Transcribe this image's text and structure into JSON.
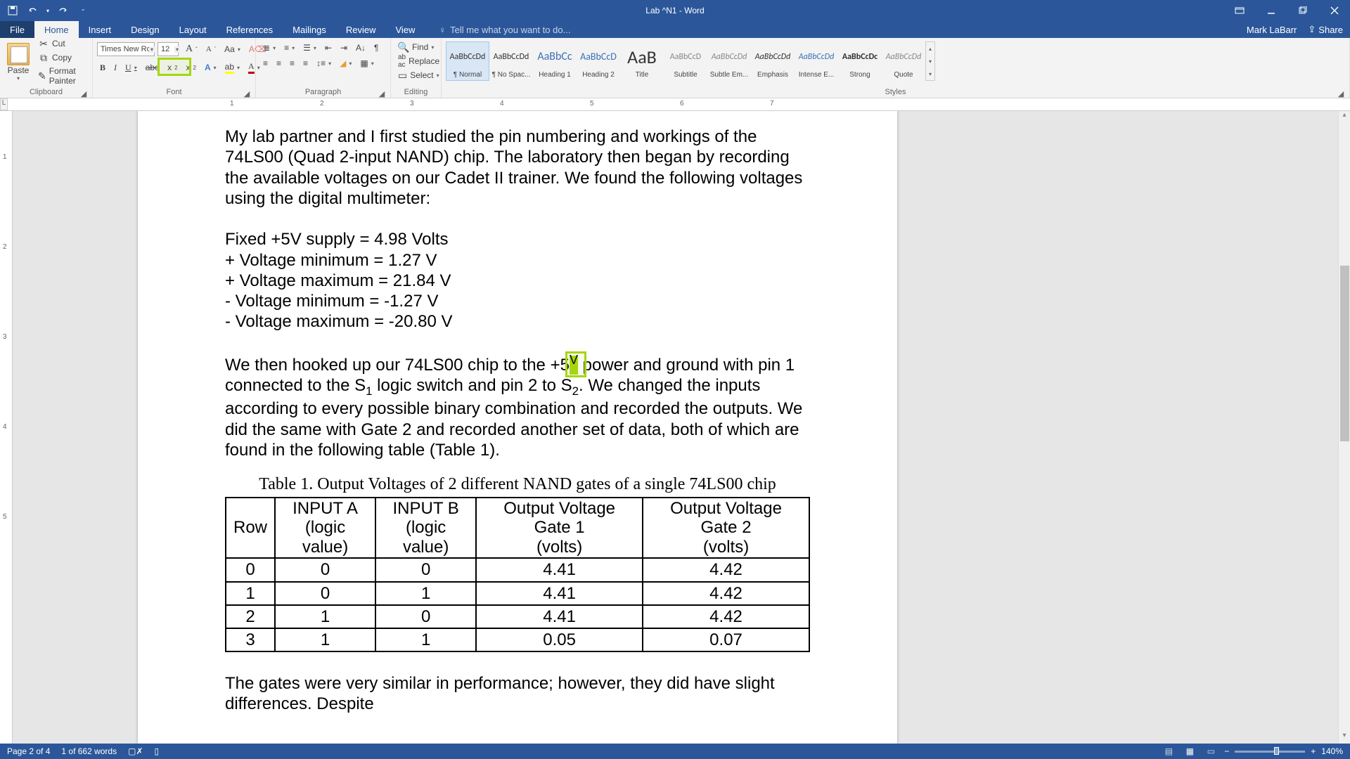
{
  "titlebar": {
    "doc_title": "Lab ^N1 - Word",
    "user": "Mark LaBarr",
    "share": "Share"
  },
  "tabs": {
    "file": "File",
    "home": "Home",
    "insert": "Insert",
    "design": "Design",
    "layout": "Layout",
    "references": "References",
    "mailings": "Mailings",
    "review": "Review",
    "view": "View",
    "tell_me": "Tell me what you want to do..."
  },
  "ribbon": {
    "paste": "Paste",
    "cut": "Cut",
    "copy": "Copy",
    "format_painter": "Format Painter",
    "clipboard": "Clipboard",
    "font_name": "Times New Ro",
    "font_size": "12",
    "font_group": "Font",
    "paragraph_group": "Paragraph",
    "find": "Find",
    "replace": "Replace",
    "select": "Select",
    "editing": "Editing",
    "styles": "Styles",
    "style_items": [
      {
        "preview": "AaBbCcDd",
        "label": "¶ Normal",
        "size": "12px",
        "color": "#333"
      },
      {
        "preview": "AaBbCcDd",
        "label": "¶ No Spac...",
        "size": "12px",
        "color": "#333"
      },
      {
        "preview": "AaBbCc",
        "label": "Heading 1",
        "size": "16px",
        "color": "#3b6fb6"
      },
      {
        "preview": "AaBbCcD",
        "label": "Heading 2",
        "size": "14px",
        "color": "#3b6fb6"
      },
      {
        "preview": "AaB",
        "label": "Title",
        "size": "26px",
        "color": "#333"
      },
      {
        "preview": "AaBbCcD",
        "label": "Subtitle",
        "size": "12px",
        "color": "#888"
      },
      {
        "preview": "AaBbCcDd",
        "label": "Subtle Em...",
        "size": "12px",
        "color": "#888",
        "italic": true
      },
      {
        "preview": "AaBbCcDd",
        "label": "Emphasis",
        "size": "12px",
        "color": "#333",
        "italic": true
      },
      {
        "preview": "AaBbCcDd",
        "label": "Intense E...",
        "size": "12px",
        "color": "#3b6fb6",
        "italic": true
      },
      {
        "preview": "AaBbCcDc",
        "label": "Strong",
        "size": "12px",
        "color": "#333",
        "bold": true
      },
      {
        "preview": "AaBbCcDd",
        "label": "Quote",
        "size": "12px",
        "color": "#888",
        "italic": true
      }
    ]
  },
  "document": {
    "p1": "My lab partner and I first studied the pin numbering and workings of the 74LS00 (Quad 2-input NAND) chip. The laboratory then began by recording the available voltages on our Cadet II trainer. We found the following voltages using the digital multimeter:",
    "l1": "Fixed +5V supply = 4.98 Volts",
    "l2": "+ Voltage minimum = 1.27 V",
    "l3": "+ Voltage maximum = 21.84 V",
    "l4": "- Voltage minimum = -1.27 V",
    "l5": "- Voltage maximum = -20.80 V",
    "p2a": "We then hooked up our 74LS00 chip to the +5",
    "p2b": " power and ground with pin 1 connected to the S",
    "p2c": " logic switch and pin 2 to S",
    "p2d": ". We changed the inputs according to every possible binary combination and recorded the outputs. We did the same with Gate 2 and recorded another set of data, both of which are found in the following table (Table 1).",
    "sup_v": "V",
    "sub_1": "1",
    "sub_2": "2",
    "table_caption": "Table 1. Output Voltages of 2 different NAND gates of a single 74LS00 chip",
    "headers": {
      "row": "Row",
      "a1": "INPUT A",
      "a2": "(logic value)",
      "b1": "INPUT B",
      "b2": "(logic value)",
      "g1a": "Output Voltage Gate 1",
      "g1b": "(volts)",
      "g2a": "Output Voltage Gate 2",
      "g2b": "(volts)"
    },
    "rows": [
      {
        "r": "0",
        "a": "0",
        "b": "0",
        "g1": "4.41",
        "g2": "4.42"
      },
      {
        "r": "1",
        "a": "0",
        "b": "1",
        "g1": "4.41",
        "g2": "4.42"
      },
      {
        "r": "2",
        "a": "1",
        "b": "0",
        "g1": "4.41",
        "g2": "4.42"
      },
      {
        "r": "3",
        "a": "1",
        "b": "1",
        "g1": "0.05",
        "g2": "0.07"
      }
    ],
    "p3": "The gates were very similar in performance; however, they did have slight differences. Despite"
  },
  "statusbar": {
    "page": "Page 2 of 4",
    "words": "1 of 662 words",
    "zoom": "140%",
    "minus": "−",
    "plus": "+"
  },
  "ruler_marks": [
    "1",
    "2",
    "3",
    "4",
    "5",
    "6",
    "7"
  ],
  "vruler_marks": [
    "1",
    "2",
    "3",
    "4",
    "5"
  ]
}
